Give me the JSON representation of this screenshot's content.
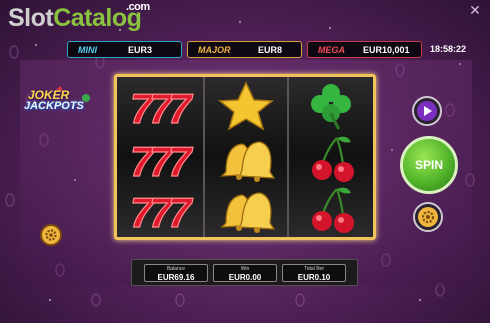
{
  "watermark": {
    "slot": "Slot",
    "catalog": "Catalog",
    "dotcom": ".com"
  },
  "window": {
    "close_glyph": "✕"
  },
  "jackpots": [
    {
      "label": "MINI",
      "value": "EUR3",
      "color": "#56d0f2"
    },
    {
      "label": "MAJOR",
      "value": "EUR8",
      "color": "#f1b640"
    },
    {
      "label": "MEGA",
      "value": "EUR10,001",
      "color": "#f04c5a"
    }
  ],
  "clock": "18:58:22",
  "logo": {
    "line1": "JOKER",
    "line2": "JACKPOTS"
  },
  "reels": [
    [
      "seven-icon",
      "seven-icon",
      "seven-icon"
    ],
    [
      "star-icon",
      "bell-icon",
      "bell-icon"
    ],
    [
      "clover-icon",
      "cherry-icon",
      "cherry-icon"
    ]
  ],
  "buttons": {
    "spin": "SPIN"
  },
  "stats": {
    "balance_label": "Balance",
    "balance_value": "EUR69.16",
    "win_label": "Win",
    "win_value": "EUR0.00",
    "totalbet_label": "Total Bet",
    "totalbet_value": "EUR0.10"
  },
  "colors": {
    "frame_gold": "#f2c25c",
    "spin_green": "#52b52a",
    "background_purple": "#5b2a63"
  }
}
